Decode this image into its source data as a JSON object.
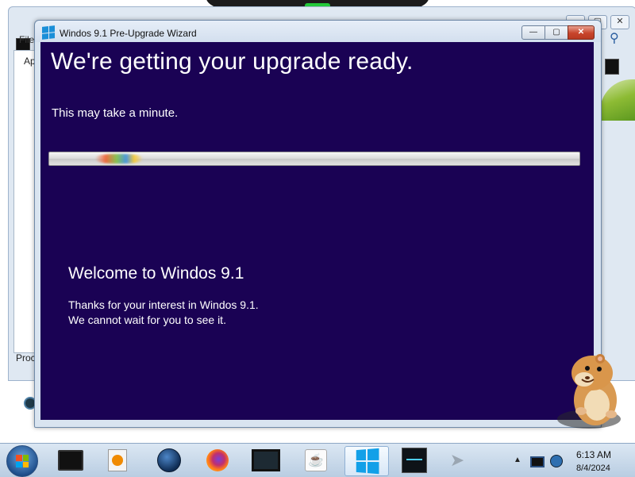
{
  "background_window": {
    "menu_text": "File",
    "panel_tab_text": "Ap",
    "bottom_text": "Proc",
    "caption_buttons": [
      "—",
      "▢",
      "✕"
    ]
  },
  "wizard": {
    "title": "Windos 9.1 Pre-Upgrade Wizard",
    "caption_buttons": {
      "minimize": "—",
      "maximize": "▢",
      "close": "✕"
    },
    "headline": "We're getting your upgrade ready.",
    "subline": "This may take a minute.",
    "welcome_title": "Welcome to Windos 9.1",
    "welcome_line1": "Thanks for your interest in Windos 9.1.",
    "welcome_line2": "We cannot wait for you to see it.",
    "content_background": "#1a0254"
  },
  "taskbar": {
    "items": [
      "black-box-icon",
      "media-player-icon",
      "globe-icon",
      "firefox-icon",
      "screen-icon",
      "java-icon",
      "windows-logo-icon",
      "monitor-app-icon",
      "arrow-cursor-icon"
    ],
    "java_glyph": "☕",
    "tray_arrow": "▲",
    "clock": {
      "time": "6:13 AM",
      "date": "8/4/2024"
    }
  }
}
